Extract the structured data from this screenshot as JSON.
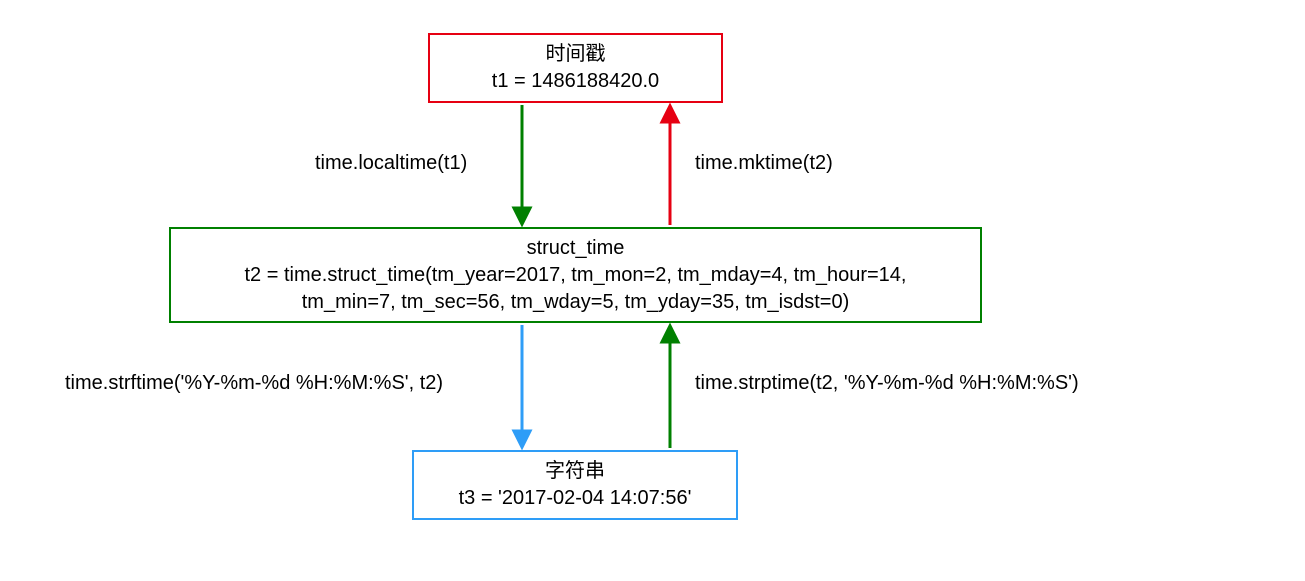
{
  "boxes": {
    "timestamp": {
      "title": "时间戳",
      "value": "t1 = 1486188420.0"
    },
    "struct_time": {
      "title": "struct_time",
      "value": "t2 = time.struct_time(tm_year=2017, tm_mon=2, tm_mday=4, tm_hour=14,\ntm_min=7, tm_sec=56, tm_wday=5, tm_yday=35, tm_isdst=0)"
    },
    "string": {
      "title": "字符串",
      "value": "t3 = '2017-02-04 14:07:56'"
    }
  },
  "edges": {
    "localtime": "time.localtime(t1)",
    "mktime": "time.mktime(t2)",
    "strftime": "time.strftime('%Y-%m-%d %H:%M:%S', t2)",
    "strptime": "time.strptime(t2, '%Y-%m-%d %H:%M:%S')"
  },
  "colors": {
    "red": "#e60012",
    "green": "#008000",
    "blue": "#2e9df7"
  }
}
